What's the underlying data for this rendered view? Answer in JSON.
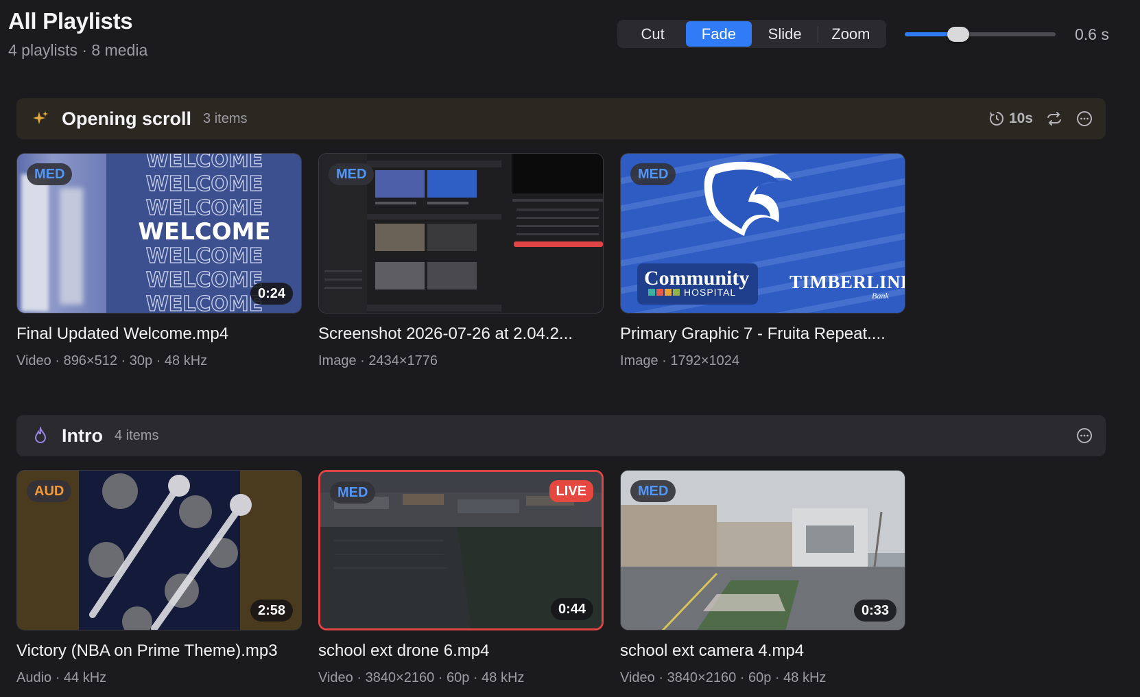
{
  "header": {
    "title": "All Playlists",
    "subtitle": "4 playlists · 8 media"
  },
  "transitions": {
    "options": [
      "Cut",
      "Fade",
      "Slide",
      "Zoom"
    ],
    "selected": "Fade",
    "duration_label": "0.6 s",
    "duration_fraction": 0.33,
    "accent_color": "#2f7cf6"
  },
  "sections": [
    {
      "title": "Opening scroll",
      "count": "3 items",
      "icon": "sparkle-icon",
      "timer": "10s",
      "bar_color": "#2b2822",
      "items": [
        {
          "badge": "MED",
          "duration": "0:24",
          "title": "Final Updated Welcome.mp4",
          "meta": "Video · 896×512 · 30p · 48 kHz",
          "thumb_text": [
            "WELCOME",
            "WELCOME",
            "WELCOME",
            "WELCOME",
            "WELCOME",
            "WELCOME",
            "WELCOME"
          ]
        },
        {
          "badge": "MED",
          "title": "Screenshot 2026-07-26 at 2.04.2...",
          "meta": "Image · 2434×1776"
        },
        {
          "badge": "MED",
          "title": "Primary Graphic 7 - Fruita Repeat....",
          "meta": "Image · 1792×1024",
          "logo_left": "Community",
          "logo_left_sub": "HOSPITAL",
          "logo_right": "TIMBERLINE",
          "logo_right_sub": "Bank"
        }
      ]
    },
    {
      "title": "Intro",
      "count": "4 items",
      "icon": "flame-icon",
      "bar_color": "#2b2b2f",
      "items": [
        {
          "badge": "AUD",
          "duration": "2:58",
          "title": "Victory (NBA on Prime Theme).mp3",
          "meta": "Audio · 44 kHz"
        },
        {
          "badge": "MED",
          "live": "LIVE",
          "duration": "0:44",
          "title": "school ext drone 6.mp4",
          "meta": "Video · 3840×2160 · 60p · 48 kHz"
        },
        {
          "badge": "MED",
          "duration": "0:33",
          "title": "school ext camera 4.mp4",
          "meta": "Video · 3840×2160 · 60p · 48 kHz"
        }
      ]
    }
  ]
}
